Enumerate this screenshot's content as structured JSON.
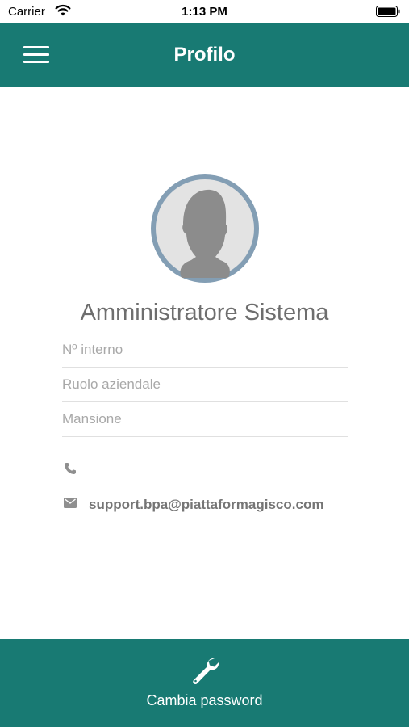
{
  "status_bar": {
    "carrier": "Carrier",
    "time": "1:13 PM"
  },
  "header": {
    "title": "Profilo",
    "menu_icon": "hamburger-menu-icon"
  },
  "profile": {
    "avatar_icon": "default-user-silhouette",
    "name": "Amministratore Sistema",
    "fields": [
      {
        "placeholder": "Nº interno"
      },
      {
        "placeholder": "Ruolo aziendale"
      },
      {
        "placeholder": "Mansione"
      }
    ],
    "phone": "",
    "email": "support.bpa@piattaformagisco.com"
  },
  "footer": {
    "icon": "wrench-icon",
    "label": "Cambia password"
  },
  "colors": {
    "primary": "#187a73",
    "avatar_border": "#839eb4",
    "text_muted": "#a8a8a8",
    "name_text": "#6e6e6e"
  }
}
